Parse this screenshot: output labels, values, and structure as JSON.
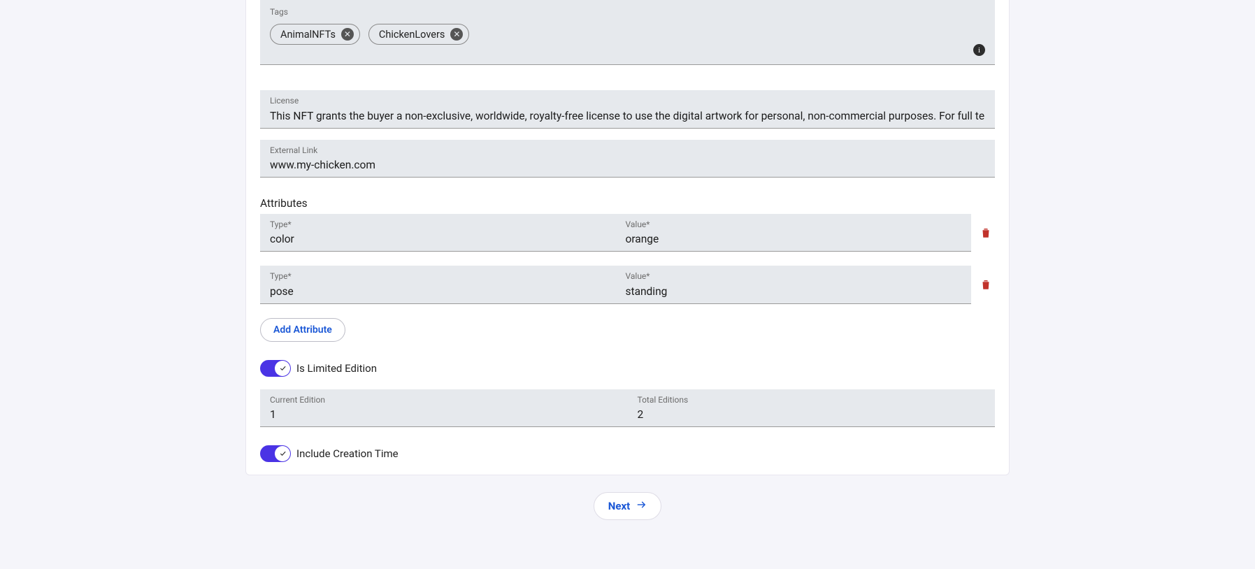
{
  "tags": {
    "label": "Tags",
    "items": [
      "AnimalNFTs",
      "ChickenLovers"
    ]
  },
  "license": {
    "label": "License",
    "value": "This NFT grants the buyer a non-exclusive, worldwide, royalty-free license to use the digital artwork for personal, non-commercial purposes. For full terms, v"
  },
  "external_link": {
    "label": "External Link",
    "value": "www.my-chicken.com"
  },
  "attributes": {
    "title": "Attributes",
    "type_label": "Type*",
    "value_label": "Value*",
    "rows": [
      {
        "type": "color",
        "value": "orange"
      },
      {
        "type": "pose",
        "value": "standing"
      }
    ],
    "add_button": "Add Attribute"
  },
  "limited": {
    "label": "Is Limited Edition",
    "on": true
  },
  "editions": {
    "current_label": "Current Edition",
    "current_value": "1",
    "total_label": "Total Editions",
    "total_value": "2"
  },
  "creation_time": {
    "label": "Include Creation Time",
    "on": true
  },
  "next_button": "Next",
  "icons": {
    "info": "info-icon",
    "remove_tag": "close-icon",
    "delete": "trash-icon",
    "check": "check-icon",
    "arrow_right": "arrow-right-icon"
  }
}
